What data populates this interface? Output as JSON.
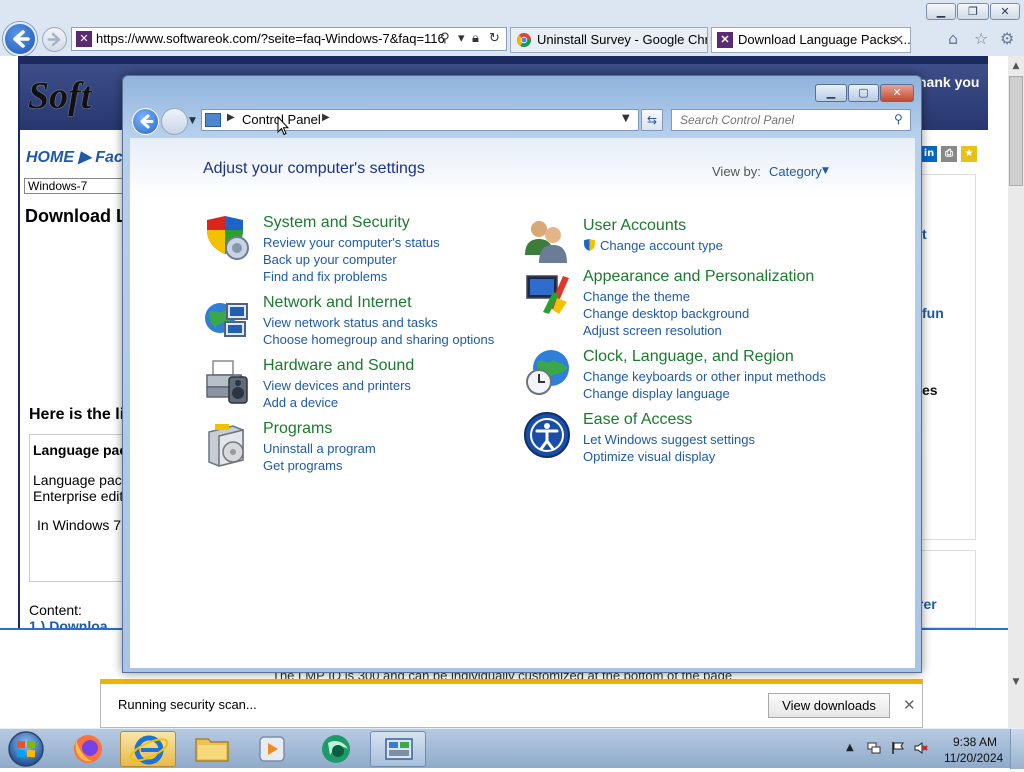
{
  "browser": {
    "url": "https://www.softwareok.com/?seite=faq-Windows-7&faq=116",
    "tabs": [
      {
        "label": "Uninstall Survey - Google Chr..."
      },
      {
        "label": "Download Language Packs ..."
      }
    ],
    "page": {
      "logo": "Soft",
      "thanks": "hank you",
      "nav": "HOME ▶ Fac",
      "select_value": "Windows-7",
      "heading": "Download L",
      "subheading": "Here is the li",
      "lang_head": "Language pac",
      "lang_t1": "Language pack",
      "lang_t2": "Enterprise editi",
      "lang_t3": "In Windows 7 F",
      "content_label": "Content:",
      "download_item": "1.)     Downloa",
      "right_1": "t",
      "right_2": "fun",
      "right_3": "es",
      "right_4": "rer",
      "bottom_text": "The LMP ID is 300 and can be individually customized at the bottom of the page"
    },
    "download_bar": {
      "status": "Running security scan...",
      "button": "View downloads"
    }
  },
  "control_panel": {
    "address": "Control Panel",
    "search_placeholder": "Search Control Panel",
    "title": "Adjust your computer's settings",
    "view_by_label": "View by:",
    "view_by_value": "Category",
    "categories": [
      {
        "title": "System and Security",
        "links": [
          "Review your computer's status",
          "Back up your computer",
          "Find and fix problems"
        ]
      },
      {
        "title": "Network and Internet",
        "links": [
          "View network status and tasks",
          "Choose homegroup and sharing options"
        ]
      },
      {
        "title": "Hardware and Sound",
        "links": [
          "View devices and printers",
          "Add a device"
        ]
      },
      {
        "title": "Programs",
        "links": [
          "Uninstall a program",
          "Get programs"
        ]
      },
      {
        "title": "User Accounts",
        "links": [
          "Change account type"
        ]
      },
      {
        "title": "Appearance and Personalization",
        "links": [
          "Change the theme",
          "Change desktop background",
          "Adjust screen resolution"
        ]
      },
      {
        "title": "Clock, Language, and Region",
        "links": [
          "Change keyboards or other input methods",
          "Change display language"
        ]
      },
      {
        "title": "Ease of Access",
        "links": [
          "Let Windows suggest settings",
          "Optimize visual display"
        ]
      }
    ]
  },
  "taskbar": {
    "time": "9:38 AM",
    "date": "11/20/2024"
  },
  "colors": {
    "link_blue": "#1e5aa8",
    "category_green": "#1a7a2e",
    "title_blue": "#1e3287",
    "download_bar_accent": "#f0b400"
  }
}
